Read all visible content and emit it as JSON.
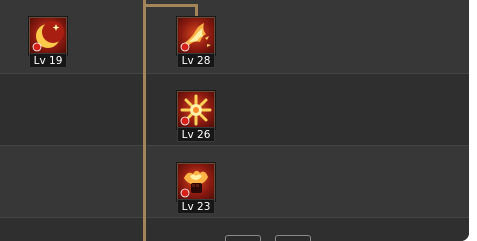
{
  "skill_tree": {
    "skills": [
      {
        "icon": "crescent-moon-icon",
        "level_label": "Lv 19"
      },
      {
        "icon": "flame-burst-icon",
        "level_label": "Lv 28"
      },
      {
        "icon": "sunburst-icon",
        "level_label": "Lv 26"
      },
      {
        "icon": "fire-fist-icon",
        "level_label": "Lv 23"
      }
    ],
    "colors": {
      "panel_background": "#363636",
      "connector_line": "#a4855a",
      "icon_red": "#b8281a",
      "icon_gold": "#ffc94a",
      "level_label_background": "#161616",
      "level_label_text": "#ffffff"
    }
  }
}
